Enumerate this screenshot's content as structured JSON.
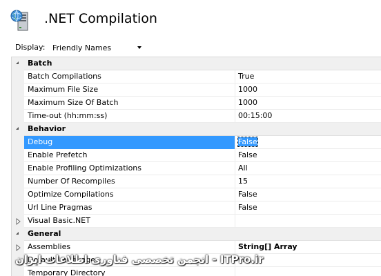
{
  "header": {
    "title": ".NET Compilation",
    "icon": "server-globe-icon"
  },
  "display": {
    "label": "Display:",
    "value": "Friendly Names"
  },
  "grid": {
    "rows": [
      {
        "kind": "category",
        "expanded": true,
        "name": "Batch"
      },
      {
        "kind": "property",
        "name": "Batch Compilations",
        "value": "True"
      },
      {
        "kind": "property",
        "name": "Maximum File Size",
        "value": "1000"
      },
      {
        "kind": "property",
        "name": "Maximum Size Of Batch",
        "value": "1000"
      },
      {
        "kind": "property",
        "name": "Time-out (hh:mm:ss)",
        "value": "00:15:00"
      },
      {
        "kind": "category",
        "expanded": true,
        "name": "Behavior"
      },
      {
        "kind": "property",
        "name": "Debug",
        "value": "False",
        "selected": true
      },
      {
        "kind": "property",
        "name": "Enable Prefetch",
        "value": "False"
      },
      {
        "kind": "property",
        "name": "Enable Profiling Optimizations",
        "value": "All"
      },
      {
        "kind": "property",
        "name": "Number Of Recompiles",
        "value": "15"
      },
      {
        "kind": "property",
        "name": "Optimize Compilations",
        "value": "False"
      },
      {
        "kind": "property",
        "name": "Url Line Pragmas",
        "value": "False"
      },
      {
        "kind": "property",
        "name": "Visual Basic.NET",
        "value": "",
        "collapsible": true
      },
      {
        "kind": "category",
        "expanded": true,
        "name": "General"
      },
      {
        "kind": "property",
        "name": "Assemblies",
        "value": "String[] Array",
        "collapsible": true,
        "bold_value": true
      },
      {
        "kind": "property",
        "name": "Default Language",
        "value": "vb"
      },
      {
        "kind": "property",
        "name": "Temporary Directory",
        "value": ""
      }
    ]
  },
  "watermark": {
    "text": "انجمن تخصصی فناوری اطلاعات ایران - ITPro.ir"
  }
}
